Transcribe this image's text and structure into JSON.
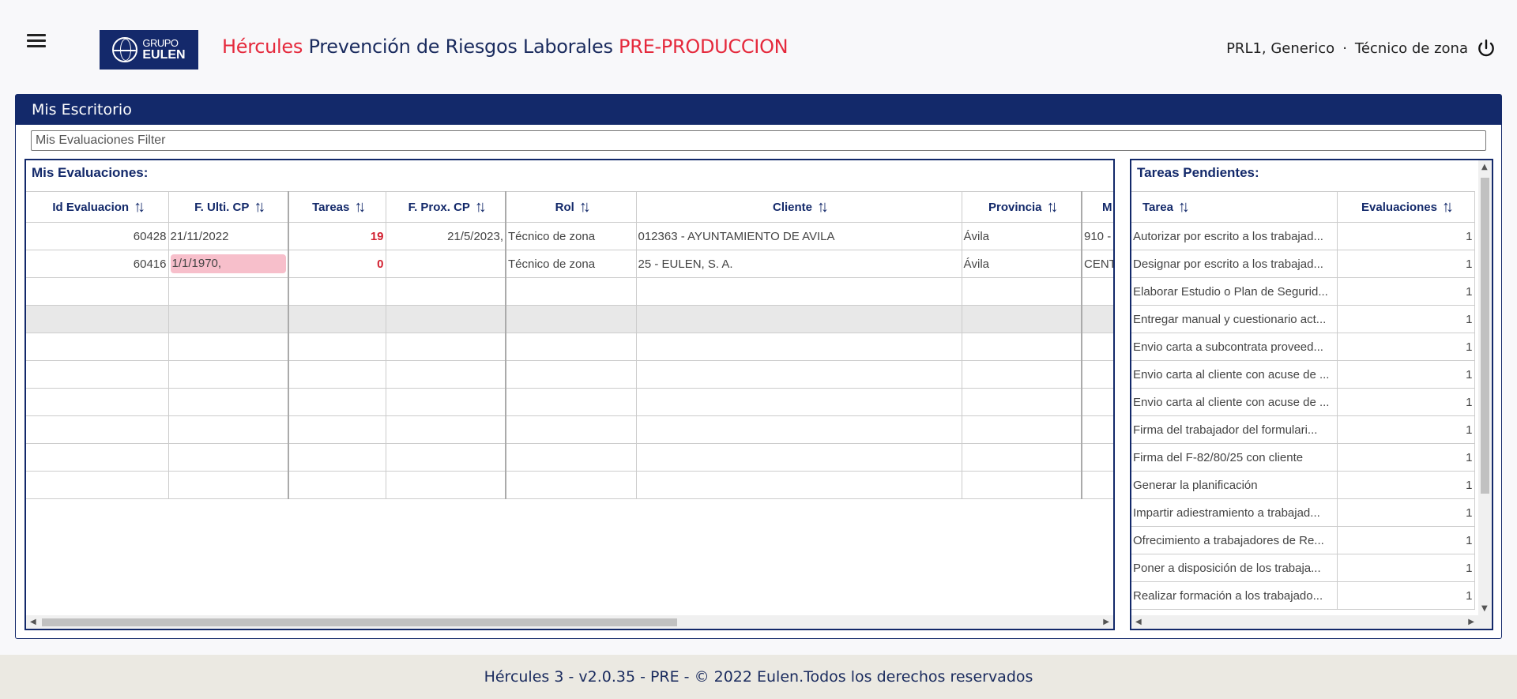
{
  "header": {
    "logo_line1": "GRUPO",
    "logo_line2": "EULEN",
    "title_part1": "Hércules",
    "title_part2": "Prevención de Riesgos Laborales",
    "title_part3": "PRE-PRODUCCION",
    "user": "PRL1, Generico",
    "separator": "·",
    "role": "Técnico de zona"
  },
  "panel": {
    "title": "Mis Escritorio",
    "filter_placeholder": "Mis Evaluaciones Filter"
  },
  "evaluaciones": {
    "title": "Mis Evaluaciones:",
    "columns": [
      "Id Evaluacion",
      "F. Ulti. CP",
      "Tareas",
      "F. Prox. CP",
      "Rol",
      "Cliente",
      "Provincia",
      "M"
    ],
    "rows": [
      [
        "60428",
        "21/11/2022",
        "19",
        "21/5/2023,",
        "Técnico de zona",
        "012363 - AYUNTAMIENTO DE AVILA",
        "Ávila",
        "910 -"
      ],
      [
        "60416",
        "1/1/1970,",
        "0",
        "",
        "Técnico de zona",
        "25 - EULEN, S. A.",
        "Ávila",
        "CENT"
      ]
    ]
  },
  "tareas": {
    "title": "Tareas Pendientes:",
    "columns": [
      "Tarea",
      "Evaluaciones"
    ],
    "rows": [
      [
        "Autorizar por escrito a los trabajad...",
        "1"
      ],
      [
        "Designar por escrito a los trabajad...",
        "1"
      ],
      [
        "Elaborar Estudio o Plan de Segurid...",
        "1"
      ],
      [
        "Entregar manual y cuestionario act...",
        "1"
      ],
      [
        "Envio carta a subcontrata proveed...",
        "1"
      ],
      [
        "Envio carta al cliente con acuse de ...",
        "1"
      ],
      [
        "Envio carta al cliente con acuse de ...",
        "1"
      ],
      [
        "Firma del trabajador del formulari...",
        "1"
      ],
      [
        "Firma del F-82/80/25 con cliente",
        "1"
      ],
      [
        "Generar la planificación",
        "1"
      ],
      [
        "Impartir adiestramiento a trabajad...",
        "1"
      ],
      [
        "Ofrecimiento a trabajadores de Re...",
        "1"
      ],
      [
        "Poner a disposición de los trabaja...",
        "1"
      ],
      [
        "Realizar formación a los trabajado...",
        "1"
      ]
    ]
  },
  "footer": {
    "text": "Hércules 3 - v2.0.35 - PRE - © 2022 Eulen.Todos los derechos reservados"
  }
}
